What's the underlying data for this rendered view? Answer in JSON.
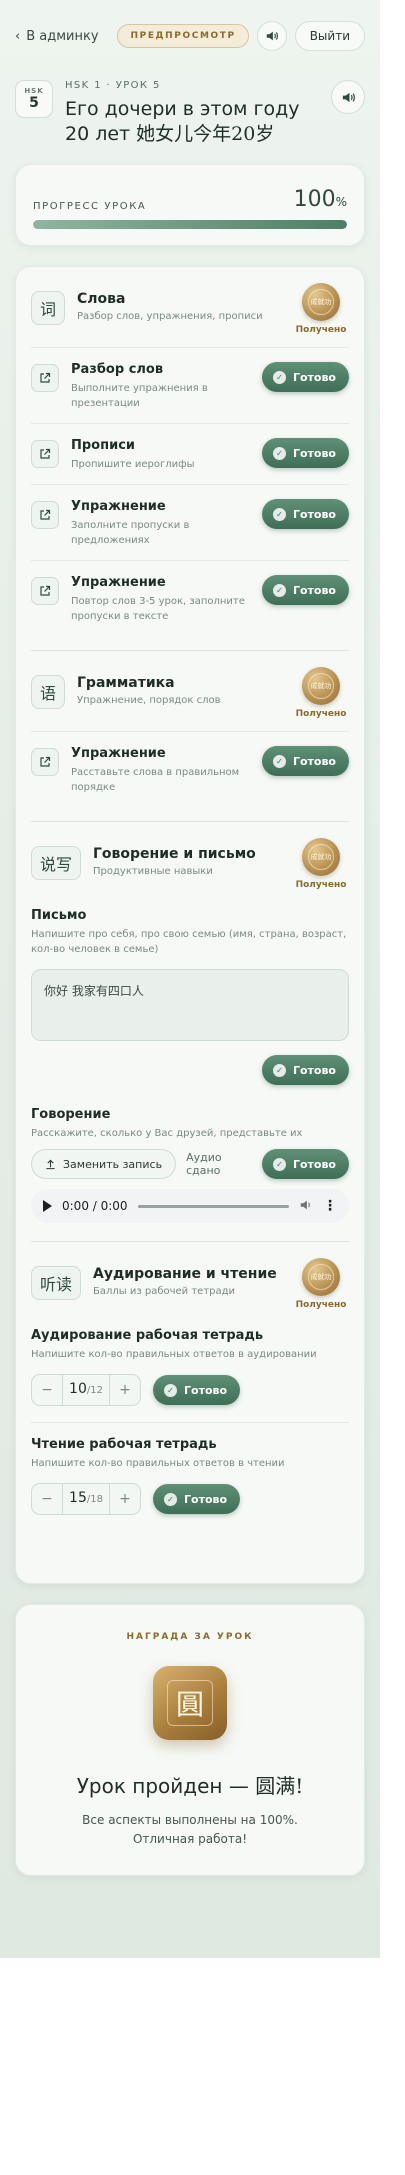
{
  "topbar": {
    "back_label": "В админку",
    "preview_label": "ПРЕДПРОСМОТР",
    "exit_label": "Выйти"
  },
  "lesson": {
    "badge_top": "HSK",
    "badge_num": "5",
    "subtitle": "HSK 1 · УРОК 5",
    "title_ru": "Его дочери в этом году 20 лет",
    "title_zh": "她女儿今年20岁"
  },
  "progress": {
    "label": "ПРОГРЕСС УРОКА",
    "value": "100",
    "unit": "%",
    "fraction": 1.0
  },
  "done_label": "Готово",
  "received_label": "Получено",
  "medal_text": "成就功",
  "sections": {
    "words": {
      "glyph": "词",
      "title": "Слова",
      "subtitle": "Разбор слов, упражнения, прописи",
      "tasks": [
        {
          "title": "Разбор слов",
          "subtitle": "Выполните упражнения в презентации"
        },
        {
          "title": "Прописи",
          "subtitle": "Пропишите иероглифы"
        },
        {
          "title": "Упражнение",
          "subtitle": "Заполните пропуски в предложениях"
        },
        {
          "title": "Упражнение",
          "subtitle": "Повтор слов 3-5 урок, заполните пропуски в тексте"
        }
      ]
    },
    "grammar": {
      "glyph": "语",
      "title": "Грамматика",
      "subtitle": "Упражнение, порядок слов",
      "tasks": [
        {
          "title": "Упражнение",
          "subtitle": "Расставьте слова в правильном порядке"
        }
      ]
    },
    "speaking": {
      "glyph": "说写",
      "title": "Говорение и письмо",
      "subtitle": "Продуктивные навыки",
      "writing_title": "Письмо",
      "writing_sub": "Напишите про себя, про свою семью (имя, страна, возраст, кол-во человек в семье)",
      "writing_value": "你好 我家有四口人",
      "speaking_title": "Говорение",
      "speaking_sub": "Расскажите, сколько у Вас друзей, представьте их",
      "replace_label": "Заменить запись",
      "audio_done": "Аудио сдано",
      "player_time": "0:00 / 0:00"
    },
    "listening": {
      "glyph": "听读",
      "title": "Аудирование и чтение",
      "subtitle": "Баллы из рабочей тетради",
      "listen_title": "Аудирование рабочая тетрадь",
      "listen_sub": "Напишите кол-во правильных ответов в аудировании",
      "listen_value": "10",
      "listen_total": "/12",
      "read_title": "Чтение рабочая тетрадь",
      "read_sub": "Напишите кол-во правильных ответов в чтении",
      "read_value": "15",
      "read_total": "/18"
    }
  },
  "reward": {
    "label": "НАГРАДА ЗА УРОК",
    "glyph": "圓",
    "title_ru": "Урок пройден — ",
    "title_zh": "圆满!",
    "subtitle": "Все аспекты выполнены на 100%. Отличная работа!"
  },
  "colors": {
    "accent": "#4f7e66",
    "gold": "#b89152",
    "background": "#e4ede6"
  }
}
